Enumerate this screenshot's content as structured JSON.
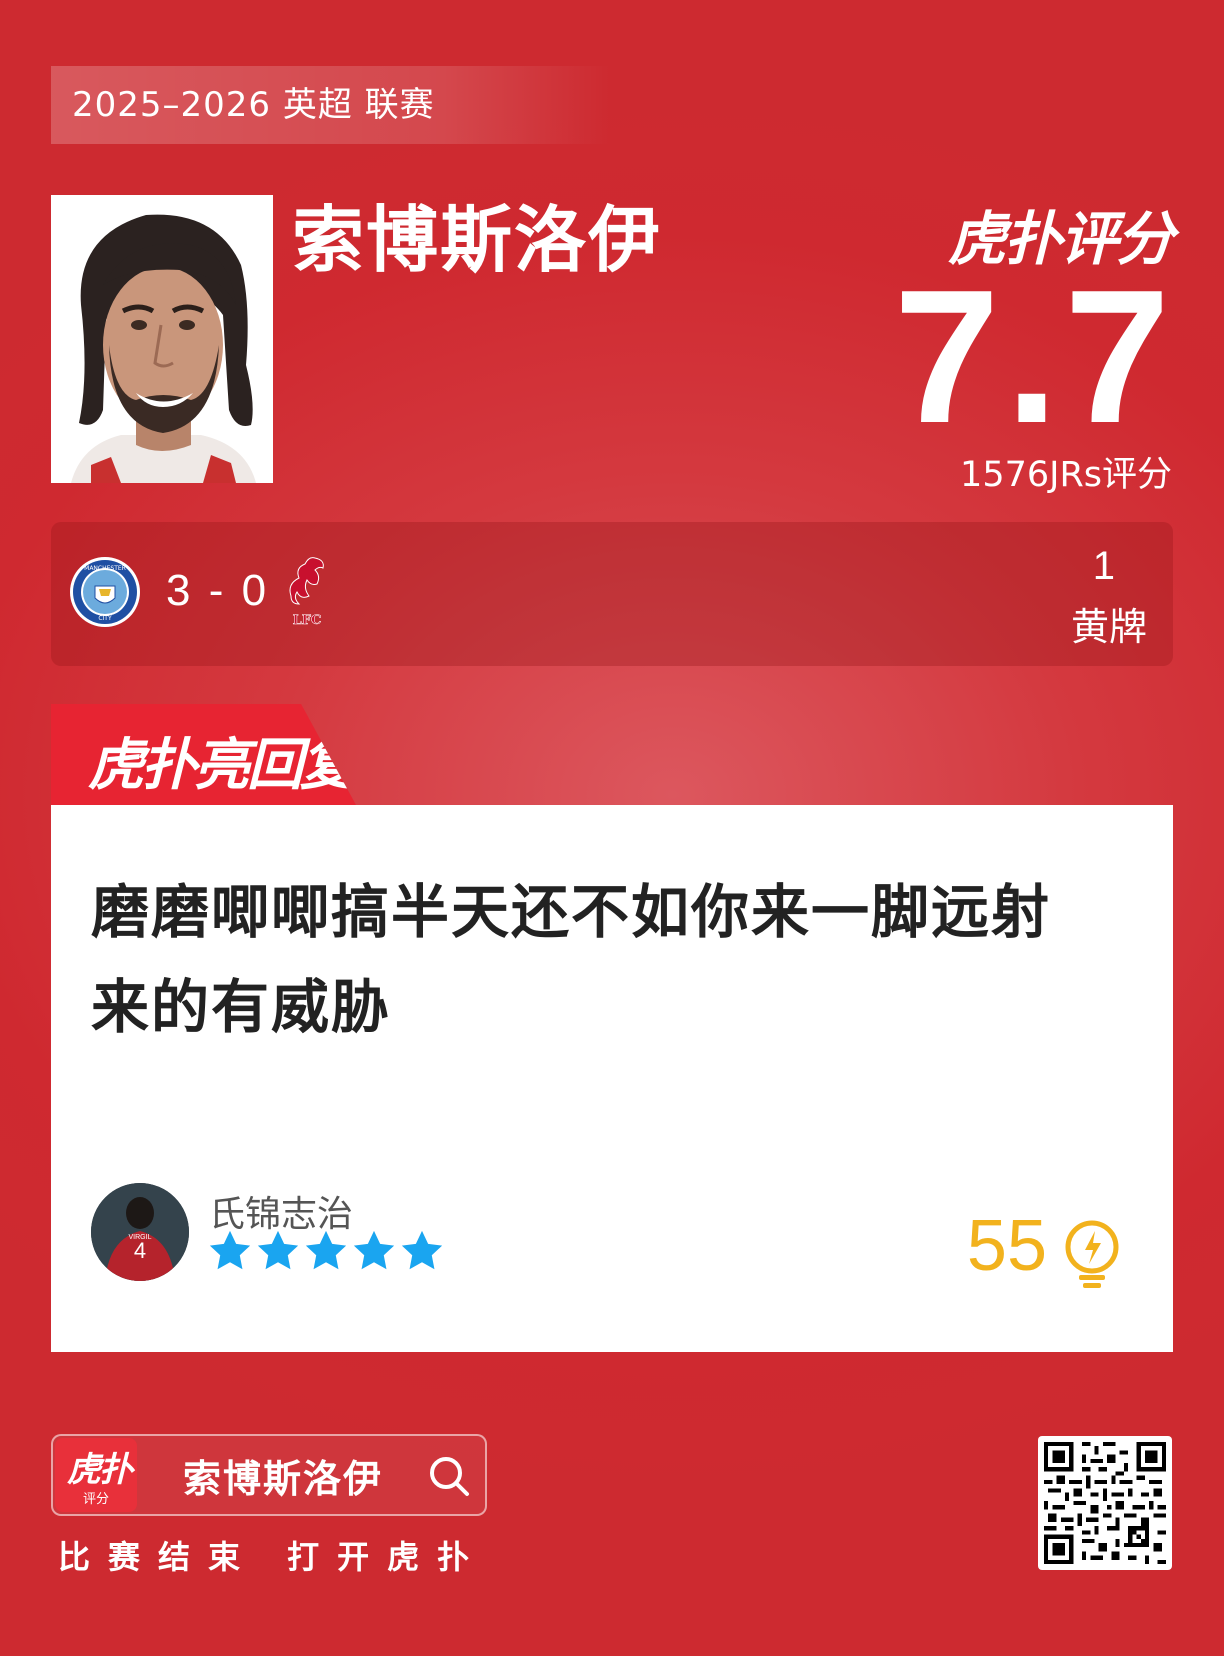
{
  "header": {
    "league": "2025–2026 英超 联赛"
  },
  "player": {
    "name": "索博斯洛伊"
  },
  "rating": {
    "brand": "虎扑评分",
    "score": "7.7",
    "count": "1576JRs评分"
  },
  "match": {
    "home_team_icon": "manchester-city-badge",
    "away_team_icon": "liverpool-fc-badge",
    "score": "3 - 0",
    "stat_value": "1",
    "stat_label": "黄牌"
  },
  "reply": {
    "tab_label": "虎扑亮回复",
    "text": "磨磨唧唧搞半天还不如你来一脚远射来的有威胁",
    "username": "氏锦志治",
    "stars": 5,
    "star_color": "#1aa5f0",
    "likes": "55",
    "likes_color": "#f2b21d",
    "like_icon": "lightbulb-icon"
  },
  "footer": {
    "app_icon_top": "虎扑",
    "app_icon_bottom": "评分",
    "search_text": "索博斯洛伊",
    "cta": "比赛结束 打开虎扑",
    "qr_icon": "qr-code"
  },
  "colors": {
    "background": "#d4393f",
    "accent": "#e72432"
  }
}
